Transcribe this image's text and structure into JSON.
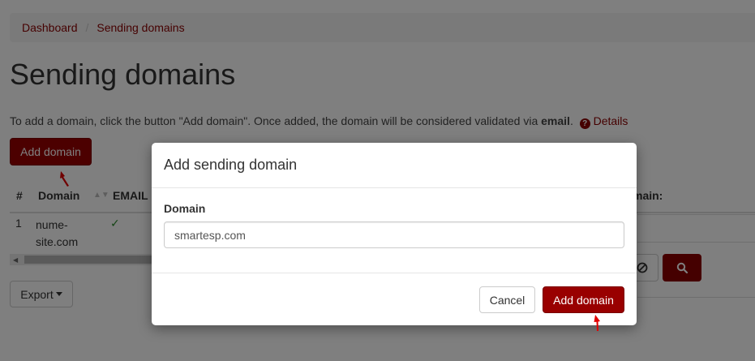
{
  "breadcrumb": {
    "items": [
      "Dashboard",
      "Sending domains"
    ],
    "separator": "/"
  },
  "page": {
    "title": "Sending domains",
    "intro_prefix": "To add a domain, click the button \"Add domain\". Once added, the domain will be considered validated via ",
    "intro_bold": "email",
    "intro_suffix": ".",
    "details_link": "Details",
    "add_button": "Add domain",
    "export_button": "Export"
  },
  "table": {
    "headers": {
      "num": "#",
      "domain": "Domain",
      "email": "EMAIL",
      "domain_right": "main:"
    },
    "rows": [
      {
        "num": "1",
        "domain": "nume-site.com",
        "email_status": "✓"
      }
    ]
  },
  "modal": {
    "title": "Add sending domain",
    "field_label": "Domain",
    "field_value": "smartesp.com",
    "cancel_button": "Cancel",
    "submit_button": "Add domain"
  },
  "colors": {
    "accent": "#990000",
    "link": "#8b0000",
    "success": "#2a8a2a"
  },
  "icons": [
    "question-circle-icon",
    "sort-icon",
    "check-icon",
    "ban-icon",
    "search-icon",
    "caret-down-icon",
    "red-arrow-annotation"
  ]
}
